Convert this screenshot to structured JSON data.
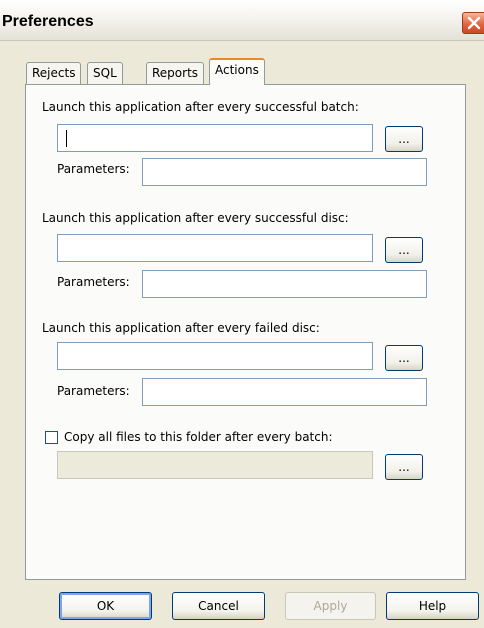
{
  "window": {
    "title": "Preferences",
    "close_icon": "close-icon"
  },
  "tabs": [
    {
      "label": "Rejects",
      "active": false
    },
    {
      "label": "SQL",
      "active": false
    },
    {
      "label": "Reports",
      "active": false
    },
    {
      "label": "Actions",
      "active": true
    }
  ],
  "actions": {
    "batch_success": {
      "label": "Launch this application after every successful batch:",
      "path": "",
      "parameters_label": "Parameters:",
      "parameters": "",
      "browse_label": "..."
    },
    "disc_success": {
      "label": "Launch this application after every successful disc:",
      "path": "",
      "parameters_label": "Parameters:",
      "parameters": "",
      "browse_label": "..."
    },
    "disc_failed": {
      "label": "Launch this application after every failed disc:",
      "path": "",
      "parameters_label": "Parameters:",
      "parameters": "",
      "browse_label": "..."
    },
    "copy_files": {
      "label": "Copy all files to this folder after every batch:",
      "checked": false,
      "folder": "",
      "browse_label": "..."
    }
  },
  "buttons": {
    "ok": "OK",
    "cancel": "Cancel",
    "apply": "Apply",
    "help": "Help"
  },
  "colors": {
    "window_bg": "#ece9d8",
    "panel_bg": "#fbfbf9",
    "active_tab_accent": "#e68b2c",
    "close_button": "#e0613a"
  }
}
